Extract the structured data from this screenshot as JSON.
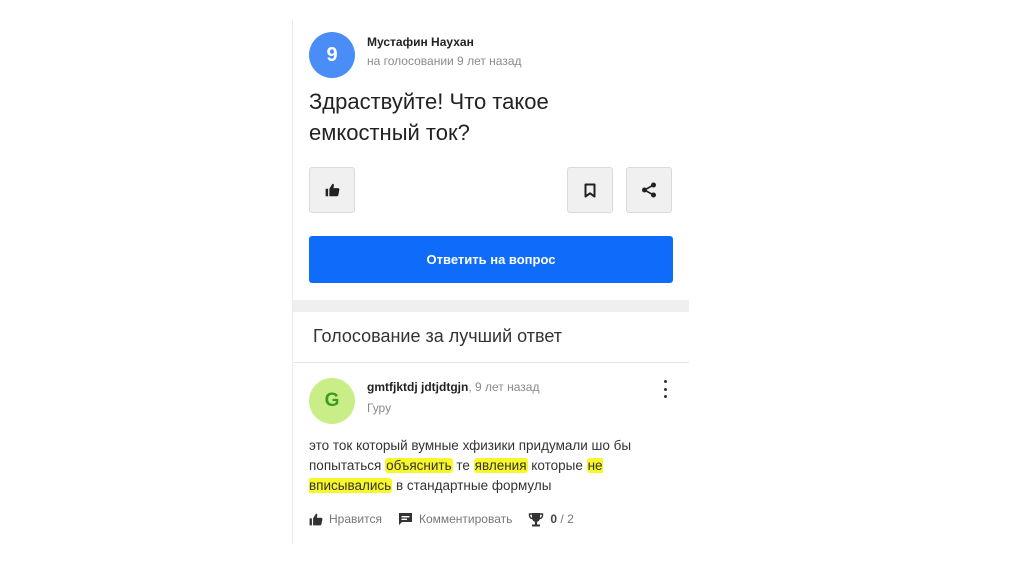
{
  "question": {
    "avatar_letter": "9",
    "author": "Мустафин Наухан",
    "meta": "на голосовании 9 лет назад",
    "text_line1": "Здраствуйте! Что такое",
    "text_line2": "емкостный ток?"
  },
  "actions": {
    "like_icon": "thumbs-up-icon",
    "bookmark_icon": "bookmark-icon",
    "share_icon": "share-icon",
    "answer_button_label": "Ответить на вопрос"
  },
  "voting": {
    "title": "Голосование за лучший ответ"
  },
  "answer": {
    "avatar_letter": "G",
    "author": "gmtfjktdj jdtjdtgjn",
    "separator": ",",
    "time": "9 лет назад",
    "rank": "Гуру",
    "text_parts": {
      "p1": "это ток который вумные хфизики придумали шо бы попытаться ",
      "h1": "объяснить",
      "p2": " те ",
      "h2": "явления",
      "p3": " которые ",
      "h3": "не вписывались",
      "p4": " в стандартные формулы"
    },
    "like_label": "Нравится",
    "comment_label": "Комментировать",
    "score_current": "0",
    "score_total": "/ 2"
  },
  "colors": {
    "primary_button": "#0f6cfb",
    "question_avatar": "#4a8df6",
    "answer_avatar": "#c9ee88",
    "highlight": "#f7f72a"
  }
}
